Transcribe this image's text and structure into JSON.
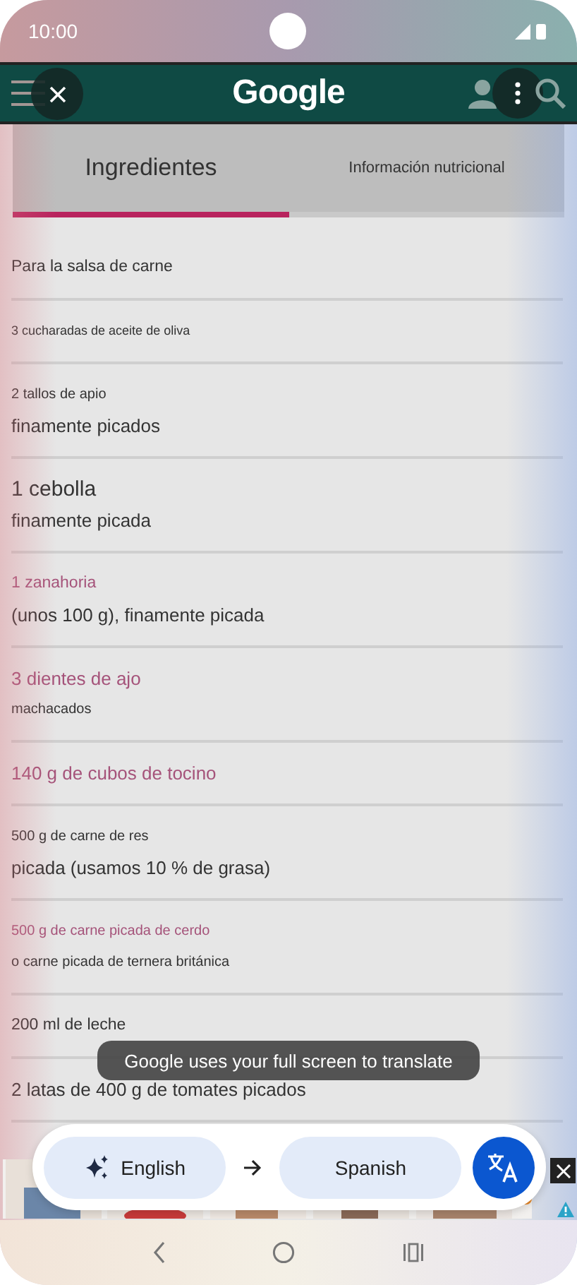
{
  "status_bar": {
    "time": "10:00"
  },
  "header": {
    "logo": "Google"
  },
  "tabs": [
    {
      "label": "Ingredientes",
      "selected": true
    },
    {
      "label": "Información nutricional",
      "selected": false
    }
  ],
  "ingredients": [
    {
      "lines": [
        {
          "text": "Para la salsa de carne",
          "kind": "medium",
          "accent": false
        }
      ]
    },
    {
      "lines": [
        {
          "text": "3 cucharadas de aceite de oliva",
          "kind": "tiny",
          "accent": false
        }
      ]
    },
    {
      "lines": [
        {
          "text": "2 tallos de apio",
          "kind": "small",
          "accent": false
        },
        {
          "text": "finamente picados",
          "kind": "large",
          "accent": false
        }
      ]
    },
    {
      "lines": [
        {
          "text": "1 cebolla",
          "kind": "xlarge",
          "accent": false
        },
        {
          "text": "finamente picada",
          "kind": "large",
          "accent": false
        }
      ]
    },
    {
      "lines": [
        {
          "text": "1 zanahoria",
          "kind": "medium",
          "accent": true
        },
        {
          "text": "(unos 100 g), finamente picada",
          "kind": "large",
          "accent": false
        }
      ]
    },
    {
      "lines": [
        {
          "text": "3 dientes de ajo",
          "kind": "large",
          "accent": true
        },
        {
          "text": "machacados",
          "kind": "small",
          "accent": false
        }
      ]
    },
    {
      "lines": [
        {
          "text": "140 g de cubos de tocino",
          "kind": "large",
          "accent": true
        }
      ]
    },
    {
      "lines": [
        {
          "text": "500 g de carne de res",
          "kind": "small",
          "accent": false
        },
        {
          "text": "picada (usamos 10 % de grasa)",
          "kind": "large",
          "accent": false
        }
      ]
    },
    {
      "lines": [
        {
          "text": "500 g de carne picada de cerdo",
          "kind": "small",
          "accent": true
        },
        {
          "text": "o carne picada de ternera británica",
          "kind": "small",
          "accent": false
        }
      ]
    },
    {
      "lines": [
        {
          "text": "200 ml de leche",
          "kind": "medium",
          "accent": false
        }
      ]
    },
    {
      "lines": [
        {
          "text": "2 latas de 400 g de tomates picados",
          "kind": "large",
          "accent": false
        }
      ]
    }
  ],
  "toast": "Google uses your full screen to translate",
  "translate_bar": {
    "source": "English",
    "target": "Spanish"
  }
}
